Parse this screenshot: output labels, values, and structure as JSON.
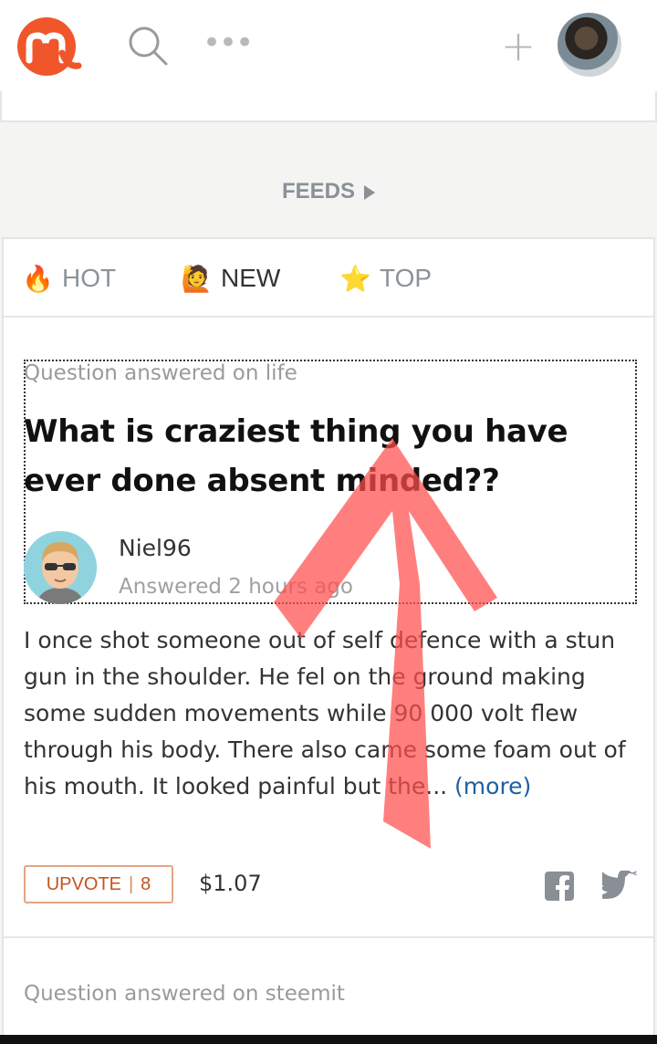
{
  "header": {
    "logo_icon": "steemit-m-logo",
    "search_icon": "search-icon",
    "more_label": "•••",
    "plus_label": "+",
    "avatar_icon": "profile-avatar"
  },
  "feeds": {
    "label": "FEEDS"
  },
  "tabs": [
    {
      "label": "HOT",
      "emoji": "🔥"
    },
    {
      "label": "NEW",
      "emoji": "🙋"
    },
    {
      "label": "TOP",
      "emoji": "⭐"
    }
  ],
  "post": {
    "category": "Question answered on life",
    "title": "What is craziest thing you have ever done absent minded??",
    "author": "Niel96",
    "answered": "Answered 2 hours ago",
    "body": "I once shot someone out of self defence with a stun gun in the shoulder. He fel on the ground making some sudden movements while 90 000 volt flew through his body. There also came some foam out of his mouth.  It looked painful but the...",
    "more": "(more)",
    "upvote_label": "UPVOTE",
    "upvote_sep": "|",
    "upvote_count": "8",
    "payout": "$1.07"
  },
  "next_post": {
    "category": "Question answered on steemit"
  },
  "colors": {
    "brand": "#f0562a",
    "link": "#1f5fa1",
    "upvote": "#c4531f",
    "annotation_arrow": "#ff4d4d"
  }
}
